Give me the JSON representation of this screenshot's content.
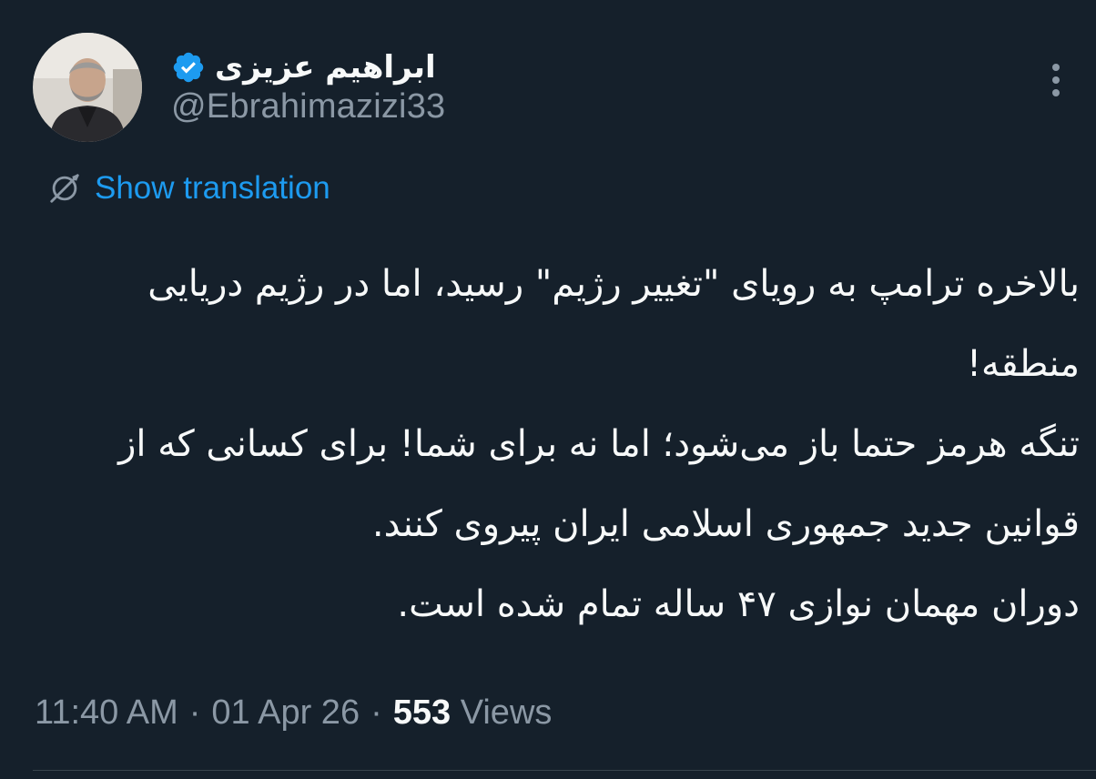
{
  "author": {
    "display_name": "ابراهیم عزیزی",
    "handle": "@Ebrahimazizi33",
    "verified": true,
    "avatar_icon": "profile-photo"
  },
  "actions": {
    "more_icon": "more-dots-icon",
    "show_translation_label": "Show translation",
    "translate_icon": "globe-icon"
  },
  "tweet": {
    "paragraphs": [
      "بالاخره ترامپ به رویای \"تغییر رژیم\" رسید، اما در رژیم دریایی منطقه!",
      "تنگه هرمز حتما باز می‌شود؛ اما نه برای شما! برای کسانی که از قوانین جدید جمهوری اسلامی ایران پیروی کنند.",
      "دوران مهمان نوازی ۴۷ ساله تمام شده است."
    ]
  },
  "meta": {
    "time": "11:40 AM",
    "separator": "·",
    "date": "01 Apr 26",
    "views_count": "553",
    "views_label": "Views"
  },
  "colors": {
    "background": "#15202b",
    "text": "#f7f9f9",
    "muted": "#8b98a5",
    "accent": "#1d9bf0"
  }
}
